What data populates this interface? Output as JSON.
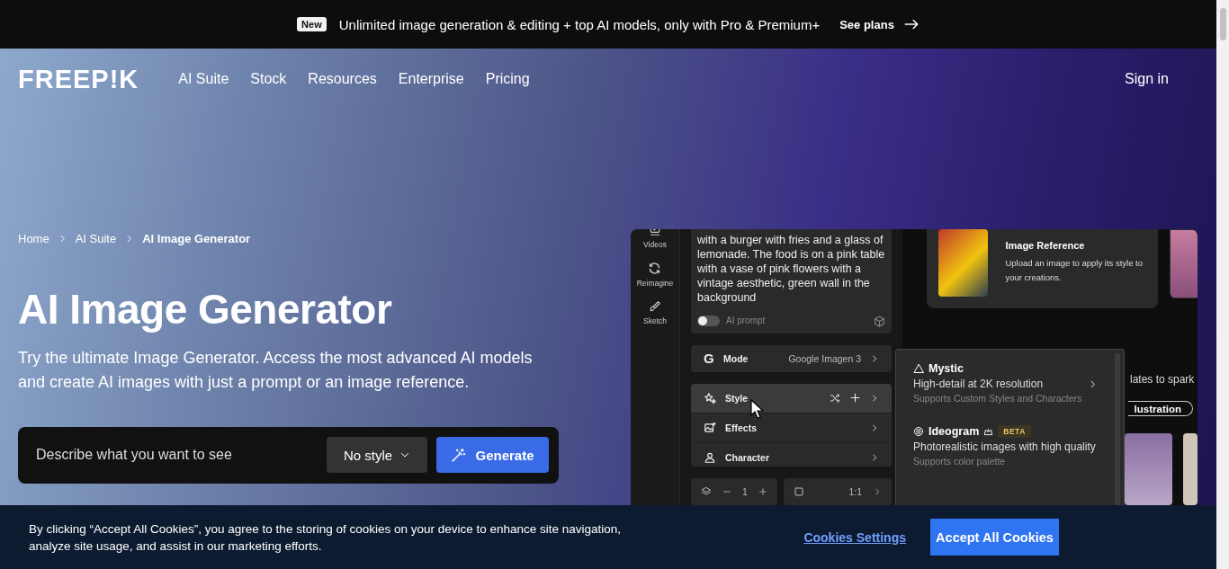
{
  "banner": {
    "badge": "New",
    "text": "Unlimited image generation & editing + top AI models, only with Pro & Premium+",
    "link": "See plans"
  },
  "nav": {
    "logo": "FREEP!K",
    "items": [
      "AI Suite",
      "Stock",
      "Resources",
      "Enterprise",
      "Pricing"
    ],
    "sign_in": "Sign in"
  },
  "breadcrumb": [
    {
      "label": "Home",
      "current": false
    },
    {
      "label": "AI Suite",
      "current": false
    },
    {
      "label": "AI Image Generator",
      "current": true
    }
  ],
  "hero": {
    "title": "AI Image Generator",
    "subtitle": "Try the ultimate Image Generator. Access the most advanced AI models and create AI images with just a prompt or an image reference."
  },
  "prompt_bar": {
    "placeholder": "Describe what you want to see",
    "style_select": "No style",
    "generate": "Generate"
  },
  "app_preview": {
    "rail": [
      {
        "kind": "video",
        "label": "Videos"
      },
      {
        "kind": "reimagine",
        "label": "Reimagine"
      },
      {
        "kind": "sketch",
        "label": "Sketch"
      }
    ],
    "prompt_text": "with a burger with fries and a glass of lemonade. The food is on a pink table with a vase of pink flowers with a vintage aesthetic, green wall in the background",
    "ai_prompt": {
      "label": "AI prompt",
      "on": false
    },
    "mode": {
      "logo_letter": "G",
      "label": "Mode",
      "value": "Google Imagen 3"
    },
    "options": [
      {
        "kind": "style",
        "label": "Style",
        "selected": true
      },
      {
        "kind": "effects",
        "label": "Effects",
        "selected": false
      },
      {
        "kind": "character",
        "label": "Character",
        "selected": false
      }
    ],
    "quantity": "1",
    "aspect_ratio": "1:1",
    "image_reference": {
      "title": "Image Reference",
      "description": "Upload an image to apply its style to your creations."
    },
    "templates_text": "lates to spark",
    "chip": "lustration",
    "model_menu": [
      {
        "kind": "mystic",
        "name": "Mystic",
        "description": "High-detail at 2K resolution",
        "note": "Supports Custom Styles and Characters"
      },
      {
        "kind": "ideogram",
        "name": "Ideogram",
        "badge": "BETA",
        "description": "Photorealistic images with high quality",
        "note": "Supports color palette"
      }
    ]
  },
  "cookie_banner": {
    "text": "By clicking “Accept All Cookies”, you agree to the storing of cookies on your device to enhance site navigation, analyze site usage, and assist in our marketing efforts.",
    "settings_link": "Cookies Settings",
    "accept": "Accept All Cookies"
  }
}
